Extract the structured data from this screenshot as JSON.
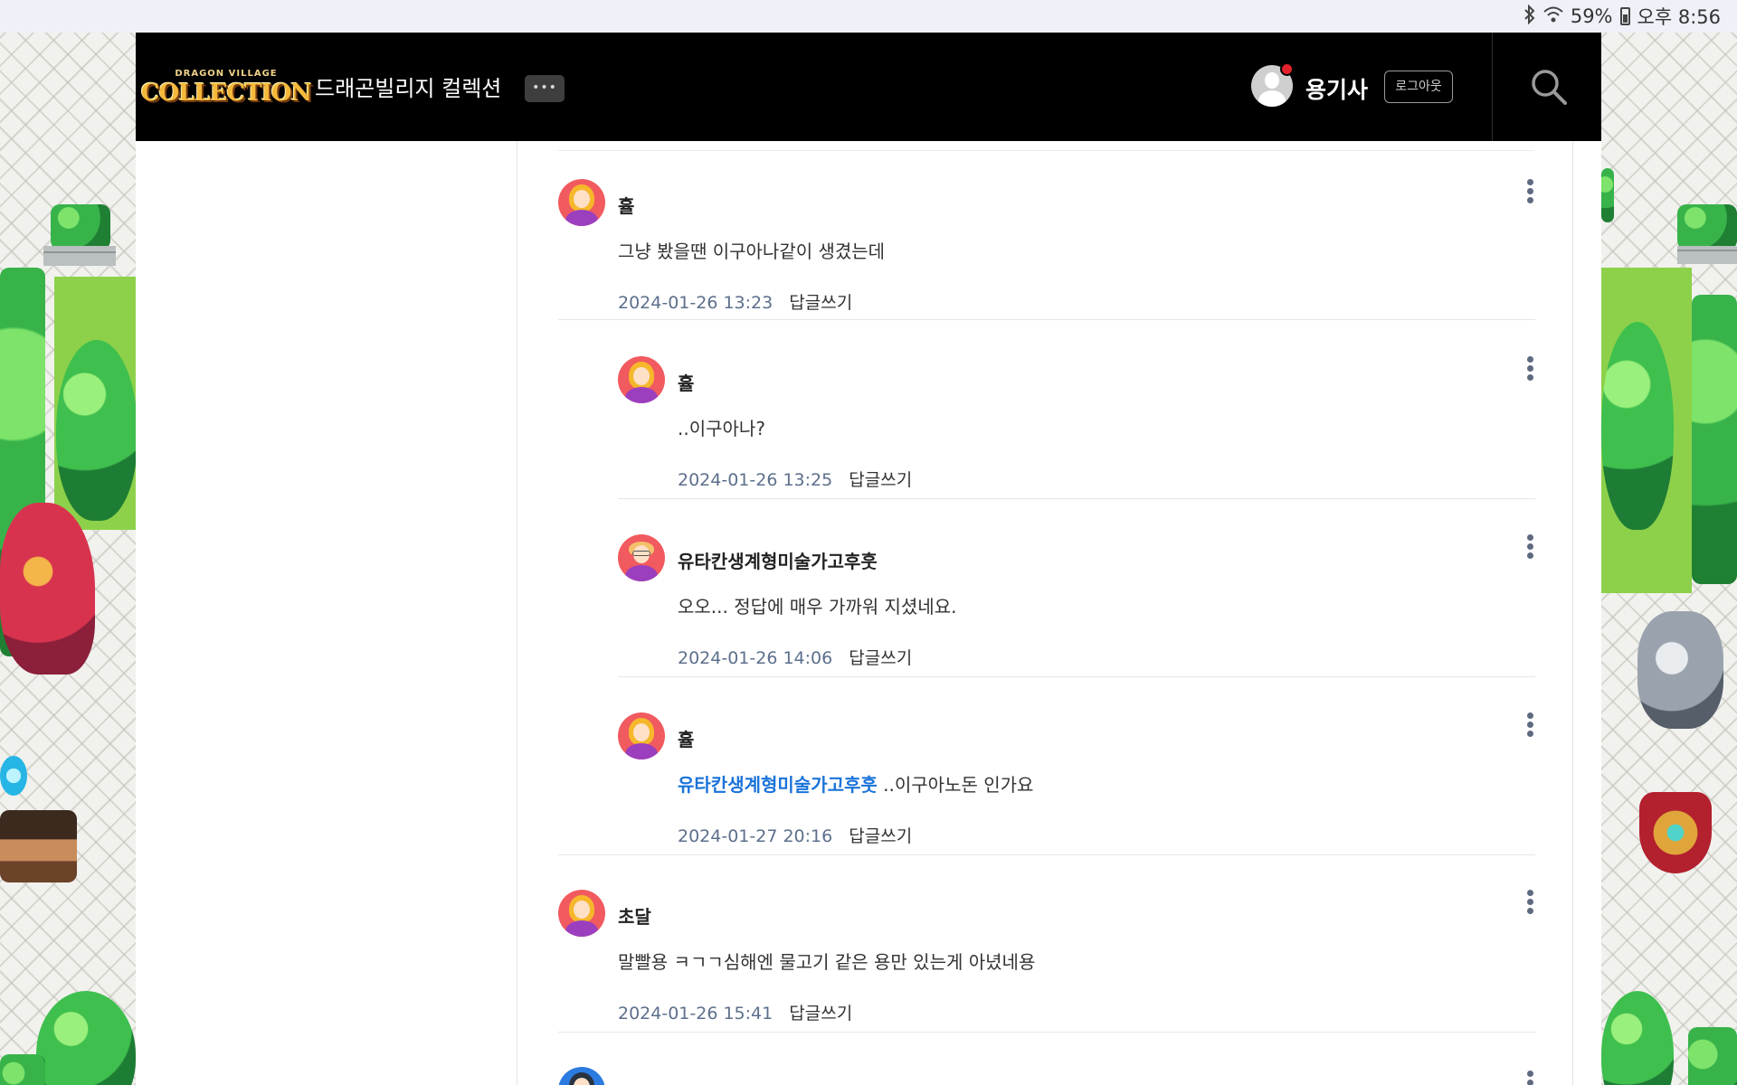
{
  "status_bar": {
    "battery": "59%",
    "time": "오후 8:56",
    "icons": [
      "bluetooth-icon",
      "wifi-icon",
      "battery-icon"
    ]
  },
  "header": {
    "logo_small": "DRAGON VILLAGE",
    "logo_main": "COLLECTION",
    "site_title": "드래곤빌리지 컬렉션",
    "more_label": "•••",
    "username": "용기사",
    "logout_label": "로그아웃"
  },
  "comments": [
    {
      "author": "휼",
      "avatar": "girl-avatar",
      "text": "그냥 봤을땐 이구아나같이 생겼는데",
      "mention": "",
      "date": "2024-01-26 13:23",
      "reply_label": "답글쓰기",
      "is_reply": false
    },
    {
      "author": "휼",
      "avatar": "girl-avatar",
      "text": "..이구아나?",
      "mention": "",
      "date": "2024-01-26 13:25",
      "reply_label": "답글쓰기",
      "is_reply": true
    },
    {
      "author": "유타칸생계형미술가고후훗",
      "avatar": "glasses-avatar",
      "text": "오오... 정답에 매우 가까워 지셨네요.",
      "mention": "",
      "date": "2024-01-26 14:06",
      "reply_label": "답글쓰기",
      "is_reply": true
    },
    {
      "author": "휼",
      "avatar": "girl-avatar",
      "text": " ..이구아노돈 인가요",
      "mention": "유타칸생계형미술가고후훗",
      "date": "2024-01-27 20:16",
      "reply_label": "답글쓰기",
      "is_reply": true
    },
    {
      "author": "초달",
      "avatar": "girl-avatar",
      "text": "말빨용 ㅋㄱㄱ심해엔 물고기 같은 용만 있는게 아녔네용",
      "mention": "",
      "date": "2024-01-26 15:41",
      "reply_label": "답글쓰기",
      "is_reply": false
    }
  ],
  "colors": {
    "header_bg": "#000000",
    "date_color": "#5d6f8c",
    "mention_color": "#1a73d9",
    "notification_dot": "#e2232b"
  }
}
